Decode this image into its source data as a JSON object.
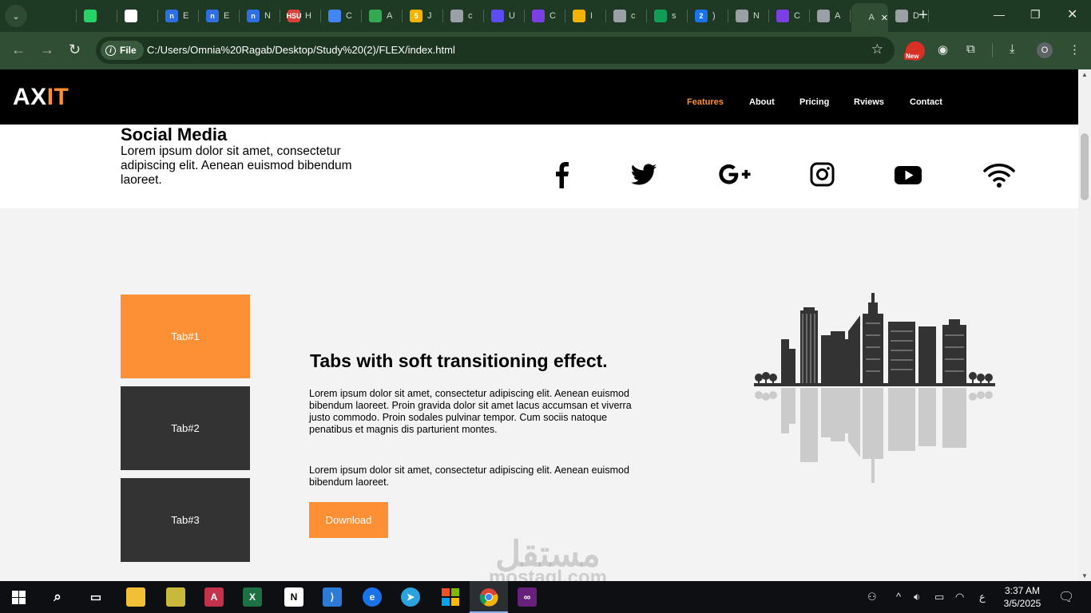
{
  "browser": {
    "tab_strip": {
      "tabs": [
        {
          "fav": "",
          "color": "#1f3a24",
          "label": "",
          "icon": "aliexpress-icon"
        },
        {
          "fav": "",
          "color": "#25d366",
          "label": "",
          "icon": "whatsapp-icon"
        },
        {
          "fav": "",
          "color": "#ffffff",
          "label": "",
          "icon": "chatgpt-icon"
        },
        {
          "fav": "n",
          "color": "#2f6fe4",
          "label": "E",
          "icon": "n-icon"
        },
        {
          "fav": "n",
          "color": "#2f6fe4",
          "label": "E",
          "icon": "n-icon"
        },
        {
          "fav": "n",
          "color": "#2f6fe4",
          "label": "N",
          "icon": "n-icon"
        },
        {
          "fav": "HSU",
          "color": "#d9413b",
          "label": "H",
          "icon": "hsu-icon"
        },
        {
          "fav": "",
          "color": "#4285f4",
          "label": "C",
          "icon": "analytics-icon"
        },
        {
          "fav": "",
          "color": "#34a853",
          "label": "A",
          "icon": "google-drive-icon"
        },
        {
          "fav": "5",
          "color": "#f3b400",
          "label": "J",
          "icon": "five-icon"
        },
        {
          "fav": "",
          "color": "#9aa0a6",
          "label": "c",
          "icon": "globe-icon"
        },
        {
          "fav": "",
          "color": "#5b4cf5",
          "label": "U",
          "icon": "video-icon"
        },
        {
          "fav": "",
          "color": "#7b3fe4",
          "label": "C",
          "icon": "p-icon"
        },
        {
          "fav": "",
          "color": "#f3b400",
          "label": "I",
          "icon": "slides-icon"
        },
        {
          "fav": "",
          "color": "#9aa0a6",
          "label": "c",
          "icon": "globe-icon"
        },
        {
          "fav": "",
          "color": "#0f9d58",
          "label": "s",
          "icon": "classroom-icon"
        },
        {
          "fav": "2",
          "color": "#1a73e8",
          "label": ")",
          "icon": "badge-icon"
        },
        {
          "fav": "",
          "color": "#9aa0a6",
          "label": "N",
          "icon": "chrome-icon"
        },
        {
          "fav": "",
          "color": "#7b3fe4",
          "label": "C",
          "icon": "p-icon"
        },
        {
          "fav": "",
          "color": "#9aa0a6",
          "label": "A",
          "icon": "globe-icon"
        },
        {
          "fav": "",
          "color": "#2f4e33",
          "label": "A",
          "icon": "active-tab",
          "active": true
        },
        {
          "fav": "",
          "color": "#9aa0a6",
          "label": "D",
          "icon": "globe-icon"
        }
      ],
      "new_tab": "+"
    },
    "address": {
      "chip_label": "File",
      "url": "C:/Users/Omnia%20Ragab/Desktop/Study%20(2)/FLEX/index.html"
    },
    "extension_badge": "New",
    "profile_initial": "O"
  },
  "site": {
    "logo": {
      "part1": "AX",
      "part2": "IT"
    },
    "nav": [
      "Features",
      "About",
      "Pricing",
      "Rviews",
      "Contact"
    ],
    "social": {
      "title": "Social Media",
      "text": "Lorem ipsum dolor sit amet, consectetur adipiscing elit. Aenean euismod bibendum laoreet.",
      "icons": [
        "facebook-icon",
        "twitter-icon",
        "google-plus-icon",
        "instagram-icon",
        "youtube-icon",
        "wifi-icon"
      ]
    },
    "tabs": [
      "Tab#1",
      "Tab#2",
      "Tab#3"
    ],
    "content": {
      "title": "Tabs with soft transitioning effect.",
      "para1": "Lorem ipsum dolor sit amet, consectetur adipiscing elit. Aenean euismod bibendum laoreet. Proin gravida dolor sit amet lacus accumsan et viverra justo commodo. Proin sodales pulvinar tempor. Cum sociis natoque penatibus et magnis dis parturient montes.",
      "para2": "Lorem ipsum dolor sit amet, consectetur adipiscing elit. Aenean euismod bibendum laoreet.",
      "button": "Download"
    },
    "accent_color": "#fd8f35",
    "watermark": {
      "arabic": "مستقل",
      "latin": "mostaql.com"
    }
  },
  "taskbar": {
    "lang": "ع",
    "time": "3:37 AM",
    "date": "3/5/2025"
  }
}
